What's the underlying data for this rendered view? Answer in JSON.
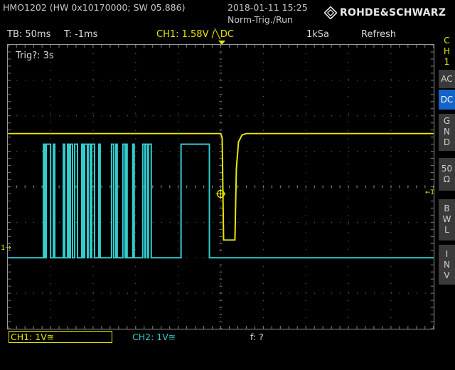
{
  "header": {
    "device_info": "HMO1202 (HW 0x10170000; SW 05.886)",
    "datetime": "2018-01-11 15:25",
    "trigger_mode": "Norm-Trig./Run",
    "brand": "ROHDE&SCHWARZ"
  },
  "status": {
    "timebase": "TB: 50ms",
    "trigger_delay": "T: -1ms",
    "ch1_trigger": "CH1: 1.58V ∕╲DC",
    "sample_rate": "1kSa",
    "acq_mode": "Refresh"
  },
  "screen": {
    "trig_status": "Trig?: 3s"
  },
  "side_menu": {
    "channel_label": [
      "C",
      "H",
      "1"
    ],
    "ac": "AC",
    "dc": "DC",
    "gnd": [
      "G",
      "N",
      "D"
    ],
    "ohm50": [
      "50",
      "Ω"
    ],
    "bwl": [
      "B",
      "W",
      "L"
    ],
    "inv": [
      "I",
      "N",
      "V"
    ]
  },
  "bottom": {
    "ch1": "CH1: 1V≅",
    "ch2": "CH2: 1V≅",
    "freq": "f: ?"
  },
  "markers": {
    "ch1": "1→",
    "trig_level": "←T"
  },
  "colors": {
    "ch1": "#e8e800",
    "ch2": "#33cccc",
    "grid": "#808080",
    "active_button": "#1464c8"
  },
  "traces": {
    "ch1_high_level_div": 1.5,
    "ch1_low_level_div": -1.5,
    "ch2_low_level_div": -2.0,
    "ch2_high_level_div": 1.2
  }
}
